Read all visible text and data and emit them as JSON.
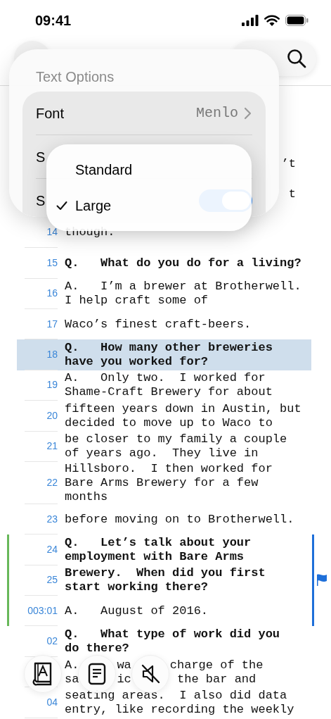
{
  "status_bar": {
    "time": "09:41"
  },
  "text_options": {
    "title": "Text Options",
    "rows": [
      {
        "kind": "link",
        "label": "Font",
        "value": "Menlo"
      },
      {
        "kind": "plain",
        "label": "S"
      },
      {
        "kind": "toggle",
        "label": "S",
        "on": true
      }
    ]
  },
  "size_menu": {
    "options": [
      {
        "label": "Standard",
        "selected": false
      },
      {
        "label": "Large",
        "selected": true
      }
    ]
  },
  "transcript": {
    "lines": [
      {
        "kind": "partial",
        "text": "’t"
      },
      {
        "kind": "partial",
        "text": "t"
      },
      {
        "kind": "line",
        "number": "14",
        "text": "though.",
        "bold": false,
        "selected": false,
        "left_marker": false,
        "right_marker": false,
        "flag": false
      },
      {
        "kind": "line",
        "number": "15",
        "text": "Q.   What do you do for a living?",
        "bold": true,
        "selected": false,
        "left_marker": false,
        "right_marker": false,
        "flag": false
      },
      {
        "kind": "line",
        "number": "16",
        "text": "A.   I’m a brewer at Brotherwell.\nI help craft some of",
        "bold": false,
        "selected": false,
        "left_marker": false,
        "right_marker": false,
        "flag": false
      },
      {
        "kind": "line",
        "number": "17",
        "text": "Waco’s finest craft-beers.",
        "bold": false,
        "selected": false,
        "left_marker": false,
        "right_marker": false,
        "flag": false
      },
      {
        "kind": "line",
        "number": "18",
        "text": "Q.   How many other breweries\nhave you worked for?",
        "bold": true,
        "selected": true,
        "left_marker": false,
        "right_marker": false,
        "flag": false
      },
      {
        "kind": "line",
        "number": "19",
        "text": "A.   Only two.  I worked for\nShame-Craft Brewery for about",
        "bold": false,
        "selected": false,
        "left_marker": false,
        "right_marker": false,
        "flag": false
      },
      {
        "kind": "line",
        "number": "20",
        "text": "fifteen years down in Austin, but\ndecided to move up to Waco to",
        "bold": false,
        "selected": false,
        "left_marker": false,
        "right_marker": false,
        "flag": false
      },
      {
        "kind": "line",
        "number": "21",
        "text": "be closer to my family a couple\nof years ago.  They live in",
        "bold": false,
        "selected": false,
        "left_marker": false,
        "right_marker": false,
        "flag": false
      },
      {
        "kind": "line",
        "number": "22",
        "text": "Hillsboro.  I then worked for\nBare Arms Brewery for a few\nmonths",
        "bold": false,
        "selected": false,
        "left_marker": false,
        "right_marker": false,
        "flag": false
      },
      {
        "kind": "line",
        "number": "23",
        "text": "before moving on to Brotherwell.",
        "bold": false,
        "selected": false,
        "left_marker": false,
        "right_marker": false,
        "flag": false
      },
      {
        "kind": "line",
        "number": "24",
        "text": "Q.   Let’s talk about your\nemployment with Bare Arms",
        "bold": true,
        "selected": false,
        "left_marker": true,
        "right_marker": true,
        "flag": false
      },
      {
        "kind": "line",
        "number": "25",
        "text": "Brewery.  When did you first\nstart working there?",
        "bold": true,
        "selected": false,
        "left_marker": true,
        "right_marker": true,
        "flag": true
      },
      {
        "kind": "line",
        "number": "003:01",
        "text": "A.   August of 2016.",
        "bold": false,
        "selected": false,
        "left_marker": true,
        "right_marker": true,
        "flag": false
      },
      {
        "kind": "line",
        "number": "02",
        "text": "Q.   What type of work did you\ndo there?",
        "bold": true,
        "selected": false,
        "left_marker": false,
        "right_marker": false,
        "flag": false
      },
      {
        "kind": "line",
        "fragments": [
          "A.\nsa",
          "wa\nic",
          "charge of the\n the bar and"
        ],
        "bold": false,
        "selected": false,
        "left_marker": false,
        "right_marker": false,
        "flag": false
      },
      {
        "kind": "line",
        "number": "04",
        "text": "seating areas.  I also did data\nentry, like recording the weekly",
        "bold": false,
        "selected": false,
        "left_marker": false,
        "right_marker": false,
        "flag": false
      }
    ]
  }
}
